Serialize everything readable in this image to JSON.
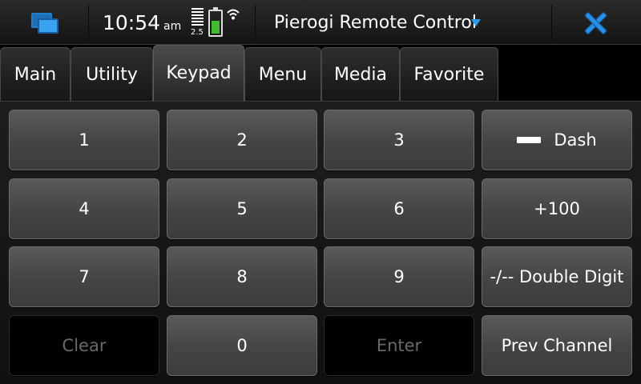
{
  "status": {
    "time": "10:54",
    "ampm": "am",
    "network_label": "2.5",
    "battery_level": 0.55
  },
  "header": {
    "title": "Pierogi Remote Control"
  },
  "tabs": [
    {
      "label": "Main"
    },
    {
      "label": "Utility"
    },
    {
      "label": "Keypad",
      "active": true
    },
    {
      "label": "Menu"
    },
    {
      "label": "Media"
    },
    {
      "label": "Favorite"
    }
  ],
  "keypad": {
    "k1": "1",
    "k2": "2",
    "k3": "3",
    "k4": "4",
    "k5": "5",
    "k6": "6",
    "k7": "7",
    "k8": "8",
    "k9": "9",
    "k0": "0",
    "clear": "Clear",
    "enter": "Enter",
    "dash": "Dash",
    "plus100": "+100",
    "double_digit": "-/-- Double Digit",
    "prev_channel": "Prev Channel"
  },
  "colors": {
    "accent": "#2c9ae8",
    "battery": "#3fbd2f"
  }
}
